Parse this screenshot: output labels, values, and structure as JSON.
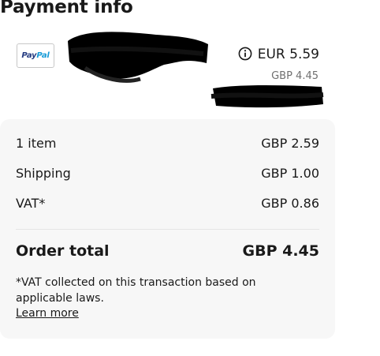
{
  "header": {
    "title": "Payment info"
  },
  "payment_method": {
    "logo_text_pay": "Pay",
    "logo_text_pal": "Pal",
    "logo_icon": "paypal-logo",
    "info_icon": "info-circle-icon",
    "amount_primary": "EUR 5.59",
    "amount_secondary": "GBP 4.45"
  },
  "summary": {
    "rows": [
      {
        "label": "1 item",
        "value": "GBP 2.59"
      },
      {
        "label": "Shipping",
        "value": "GBP 1.00"
      },
      {
        "label": "VAT*",
        "value": "GBP 0.86"
      }
    ],
    "total_label": "Order total",
    "total_value": "GBP 4.45",
    "vat_note": "*VAT collected on this transaction based on applicable laws.",
    "learn_more": "Learn more"
  },
  "colors": {
    "text": "#191919",
    "muted": "#707070",
    "panel": "#f7f7f7",
    "paypal_dark": "#253b80",
    "paypal_light": "#179bd7"
  }
}
